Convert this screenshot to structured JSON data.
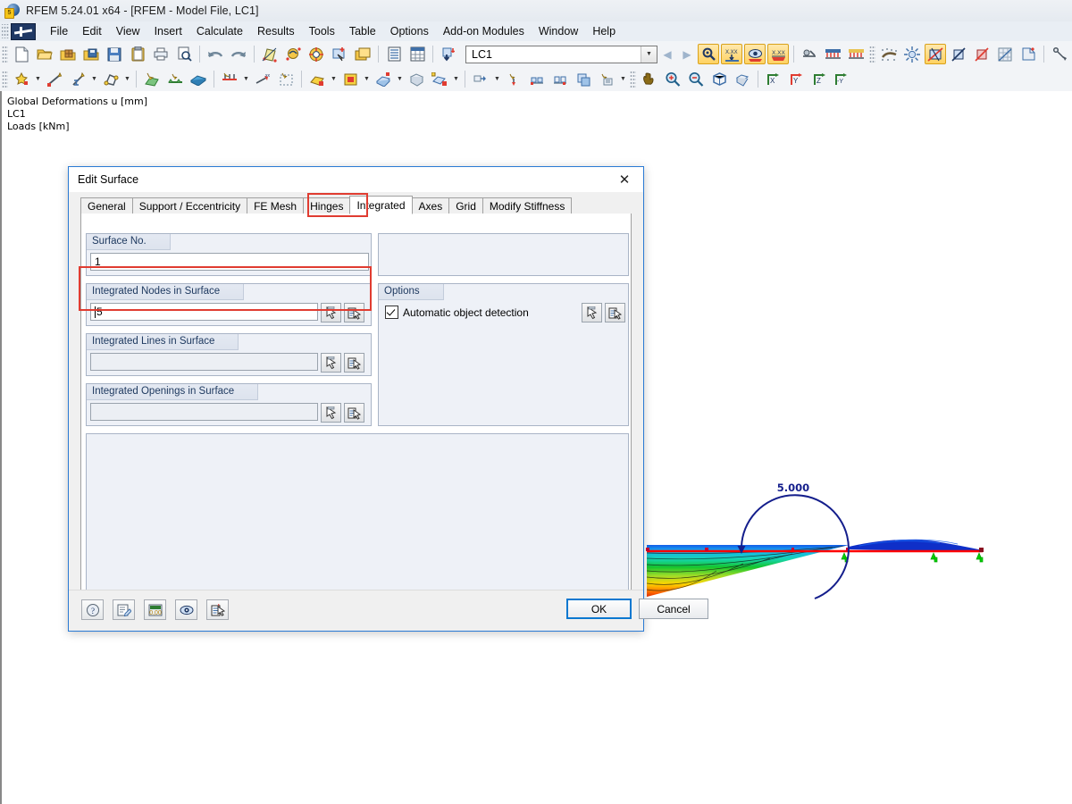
{
  "window": {
    "title": "RFEM 5.24.01 x64 - [RFEM - Model File, LC1]",
    "logo_tag": "5"
  },
  "menubar": {
    "items": [
      {
        "label": "File",
        "accel": "F"
      },
      {
        "label": "Edit",
        "accel": "E"
      },
      {
        "label": "View",
        "accel": "V"
      },
      {
        "label": "Insert",
        "accel": "I"
      },
      {
        "label": "Calculate",
        "accel": "C"
      },
      {
        "label": "Results",
        "accel": "R"
      },
      {
        "label": "Tools",
        "accel": "T"
      },
      {
        "label": "Table",
        "accel": "b"
      },
      {
        "label": "Options",
        "accel": "O"
      },
      {
        "label": "Add-on Modules",
        "accel": "A"
      },
      {
        "label": "Window",
        "accel": "W"
      },
      {
        "label": "Help",
        "accel": "H"
      }
    ]
  },
  "toolbar": {
    "loadcase": {
      "value": "LC1",
      "placeholder": "Load case"
    },
    "row1_icons": [
      "new-file-icon",
      "open-folder-icon",
      "open-package-icon",
      "save-as-icon",
      "save-icon",
      "clipboard-icon",
      "print-icon",
      "print-preview-icon",
      "undo-icon",
      "redo-icon",
      "render-surface-icon",
      "deformation-icon",
      "results-icon",
      "select-plus-icon",
      "window-icon",
      "table-icon",
      "table-grid-icon",
      "import-icon"
    ],
    "row1_icons_right": [
      "zoom-result-icon",
      "value-down-icon",
      "visibility-result-icon",
      "value-xx-icon",
      "support-icon",
      "loads-icon",
      "loads-2-icon",
      "mesh-icon",
      "fe-mesh-icon",
      "view-3d-icon",
      "view-3d-b-icon",
      "view-3d-c-icon",
      "grid-snap-icon",
      "section-icon",
      "node-snap-icon",
      "rotate-icon",
      "mirror-icon",
      "delete-node-icon",
      "info-icon",
      "camera-icon",
      "settings-icon"
    ],
    "row2_icons": [
      "node-icon",
      "line-icon",
      "member-icon",
      "polyline-icon",
      "surface-icon",
      "support-node-icon",
      "solid-icon",
      "member-load-icon",
      "nodal-load-icon",
      "selection-icon",
      "surface-load-icon",
      "opening-icon",
      "solid-load-icon",
      "solid-3d-icon",
      "surface-set-icon",
      "block-icon",
      "dimension-icon",
      "stamp-icon",
      "scale-icon",
      "copy-icon",
      "print-block-icon",
      "move-icon",
      "pan-icon",
      "zoom-in-icon",
      "zoom-out-icon",
      "box-view-icon",
      "iso-view-icon",
      "axis-x-icon",
      "axis-y-icon",
      "axis-z-icon",
      "axis-neg-y-icon"
    ]
  },
  "viewport": {
    "labels": "Global Deformations u [mm]\nLC1\nLoads [kNm]",
    "moment_label": "5.000"
  },
  "dialog": {
    "title": "Edit Surface",
    "close_icon": "close-icon",
    "tabs": [
      {
        "label": "General",
        "selected": false
      },
      {
        "label": "Support / Eccentricity",
        "selected": false
      },
      {
        "label": "FE Mesh",
        "selected": false
      },
      {
        "label": "Hinges",
        "selected": false
      },
      {
        "label": "Integrated",
        "selected": true
      },
      {
        "label": "Axes",
        "selected": false
      },
      {
        "label": "Grid",
        "selected": false
      },
      {
        "label": "Modify Stiffness",
        "selected": false
      }
    ],
    "groups": {
      "surface_no": {
        "title": "Surface No.",
        "value": "1"
      },
      "integrated_nodes": {
        "title": "Integrated Nodes in Surface",
        "value": "5",
        "pick_icon": "pick-cursor-icon",
        "list_pick_icon": "pick-list-icon"
      },
      "integrated_lines": {
        "title": "Integrated Lines in Surface",
        "value": "",
        "pick_icon": "pick-cursor-icon",
        "list_pick_icon": "pick-list-icon"
      },
      "integrated_openings": {
        "title": "Integrated Openings in Surface",
        "value": "",
        "pick_icon": "pick-cursor-icon",
        "list_pick_icon": "pick-list-icon"
      },
      "options": {
        "title": "Options",
        "checkbox_label": "Automatic object detection",
        "checkbox_checked": true,
        "pick_icon": "pick-cursor-icon",
        "list_pick_icon": "pick-list-icon"
      }
    },
    "footer": {
      "help_icon": "help-icon",
      "comment_icon": "comment-icon",
      "units_icon": "units-icon",
      "view_icon": "eye-icon",
      "details_icon": "details-icon",
      "ok_label": "OK",
      "cancel_label": "Cancel"
    }
  },
  "colors": {
    "accent": "#0b78d0",
    "highlight_red": "#e03c31",
    "dialog_border": "#2a7ad4",
    "toolbar_active": "#ffd262",
    "group_title_text": "#1f3a60"
  }
}
